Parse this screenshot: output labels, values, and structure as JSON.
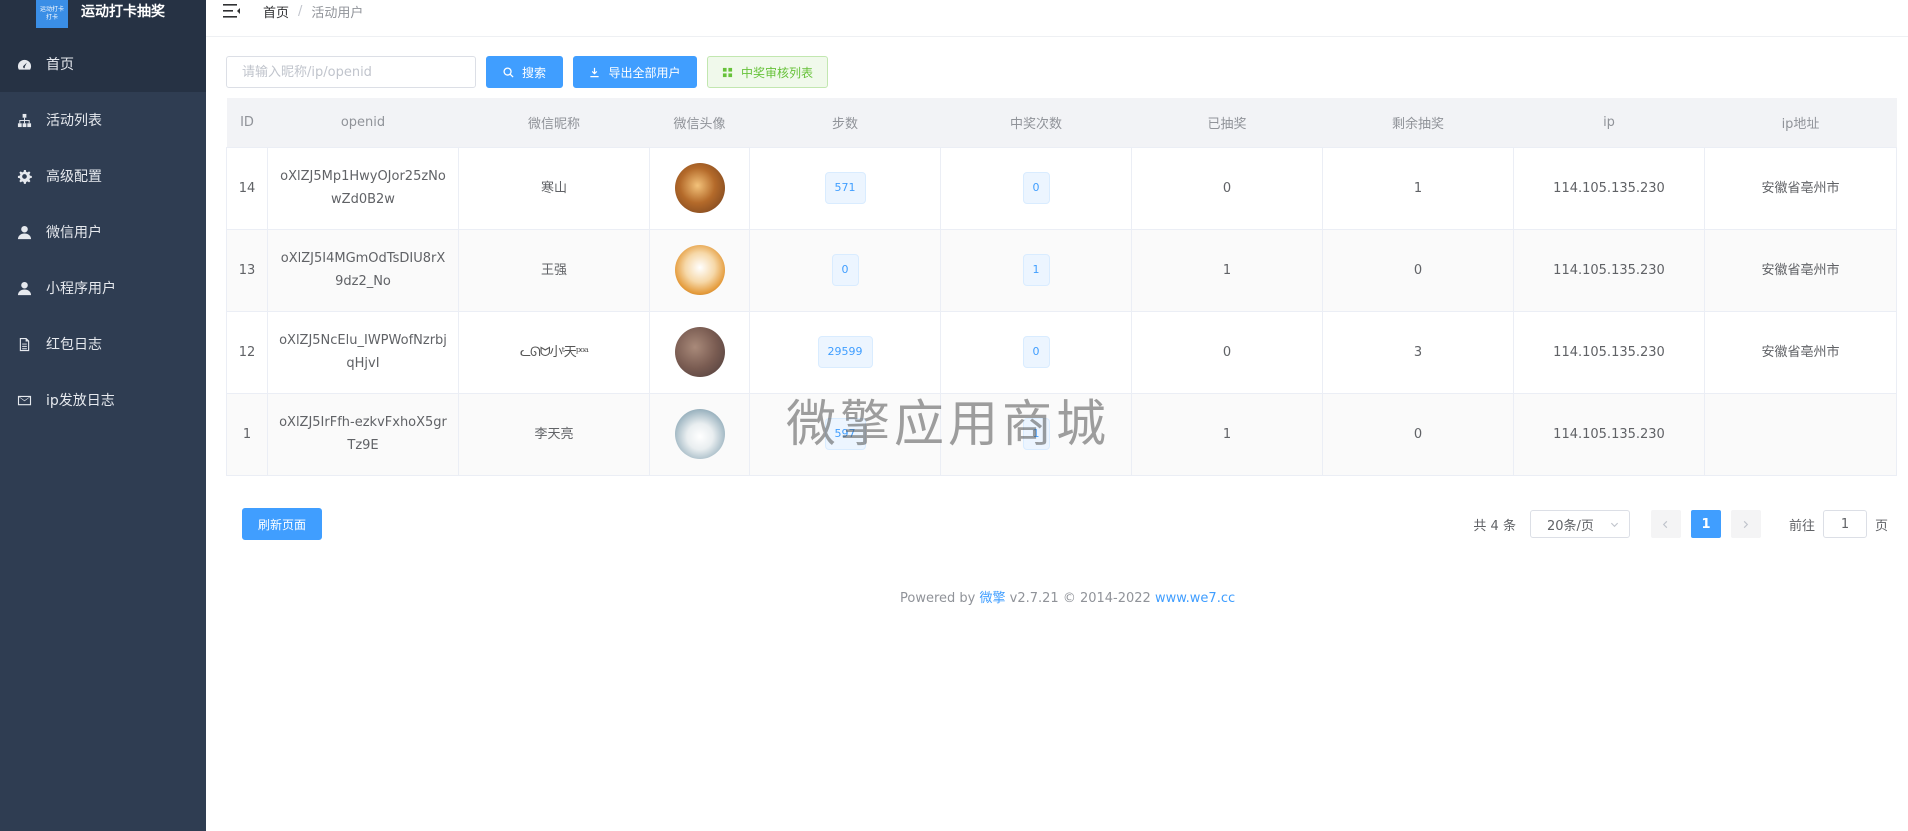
{
  "brand": {
    "title": "运动打卡抽奖",
    "logo_line1": "运动打卡",
    "logo_line2": "打卡"
  },
  "sidebar": {
    "items": [
      {
        "label": "首页",
        "icon": "dashboard-icon",
        "active": true
      },
      {
        "label": "活动列表",
        "icon": "sitemap-icon",
        "active": false
      },
      {
        "label": "高级配置",
        "icon": "gear-icon",
        "active": false
      },
      {
        "label": "微信用户",
        "icon": "user-icon",
        "active": false
      },
      {
        "label": "小程序用户",
        "icon": "user-icon",
        "active": false
      },
      {
        "label": "红包日志",
        "icon": "document-icon",
        "active": false
      },
      {
        "label": "ip发放日志",
        "icon": "envelope-icon",
        "active": false
      }
    ]
  },
  "breadcrumb": {
    "home": "首页",
    "separator": "/",
    "current": "活动用户"
  },
  "toolbar": {
    "search_placeholder": "请输入昵称/ip/openid",
    "search_label": "搜索",
    "export_label": "导出全部用户",
    "audit_label": "中奖审核列表"
  },
  "table": {
    "headers": [
      "ID",
      "openid",
      "微信昵称",
      "微信头像",
      "步数",
      "中奖次数",
      "已抽奖",
      "剩余抽奖",
      "ip",
      "ip地址"
    ],
    "rows": [
      {
        "id": "14",
        "openid": "oXlZJ5Mp1HwyOJor25zNowZd0B2w",
        "nickname": "寒山",
        "steps": "571",
        "wins": "0",
        "drawn": "0",
        "remaining": "1",
        "ip": "114.105.135.230",
        "location": "安徽省亳州市"
      },
      {
        "id": "13",
        "openid": "oXlZJ5I4MGmOdTsDIU8rX9dz2_No",
        "nickname": "王强",
        "steps": "0",
        "wins": "1",
        "drawn": "1",
        "remaining": "0",
        "ip": "114.105.135.230",
        "location": "安徽省亳州市"
      },
      {
        "id": "12",
        "openid": "oXlZJ5NcElu_IWPWofNzrbjqHjvI",
        "nickname": "ᓚᘏᗢ小ᵗ天ᵖᵒᵃ",
        "steps": "29599",
        "wins": "0",
        "drawn": "0",
        "remaining": "3",
        "ip": "114.105.135.230",
        "location": "安徽省亳州市"
      },
      {
        "id": "1",
        "openid": "oXlZJ5IrFfh-ezkvFxhoX5grTz9E",
        "nickname": "李天亮",
        "steps": "597",
        "wins": "1",
        "drawn": "1",
        "remaining": "0",
        "ip": "114.105.135.230",
        "location": ""
      }
    ]
  },
  "watermark": "微擎应用商城",
  "pagination": {
    "refresh_label": "刷新页面",
    "total": "共 4 条",
    "page_size": "20条/页",
    "current_page": "1",
    "goto_prefix": "前往",
    "goto_value": "1",
    "goto_suffix": "页"
  },
  "footer": {
    "powered_prefix": "Powered by",
    "brand_link": "微擎",
    "version": "v2.7.21 © 2014-2022",
    "site_link": "www.we7.cc"
  },
  "colors": {
    "sidebar": "#2f3d52",
    "primary": "#409eff",
    "success": "#67c23a"
  }
}
